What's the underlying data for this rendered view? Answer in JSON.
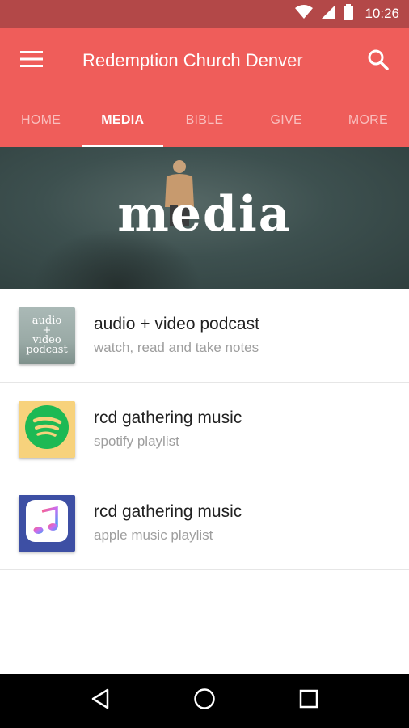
{
  "status_bar": {
    "time": "10:26",
    "icons": [
      "wifi-icon",
      "signal-icon",
      "battery-icon"
    ]
  },
  "app_bar": {
    "title": "Redemption Church Denver",
    "menu_icon": "menu-icon",
    "search_icon": "search-icon"
  },
  "tabs": [
    {
      "label": "HOME",
      "active": false
    },
    {
      "label": "MEDIA",
      "active": true
    },
    {
      "label": "BIBLE",
      "active": false
    },
    {
      "label": "GIVE",
      "active": false
    },
    {
      "label": "MORE",
      "active": false
    }
  ],
  "hero": {
    "text": "media"
  },
  "list": [
    {
      "title": "audio + video podcast",
      "subtitle": "watch, read and take notes",
      "thumb_lines": [
        "audio",
        "+",
        "video",
        "podcast"
      ]
    },
    {
      "title": "rcd gathering music",
      "subtitle": "spotify playlist",
      "thumb_icon": "spotify-icon"
    },
    {
      "title": "rcd gathering music",
      "subtitle": "apple music playlist",
      "thumb_icon": "apple-music-icon"
    }
  ],
  "nav_bar": {
    "icons": [
      "back-icon",
      "home-icon",
      "recents-icon"
    ]
  },
  "colors": {
    "primary": "#ef5d5a",
    "status_bar": "#b34848",
    "spotify_green": "#1db954",
    "apple_bg": "#3d4fa4"
  }
}
